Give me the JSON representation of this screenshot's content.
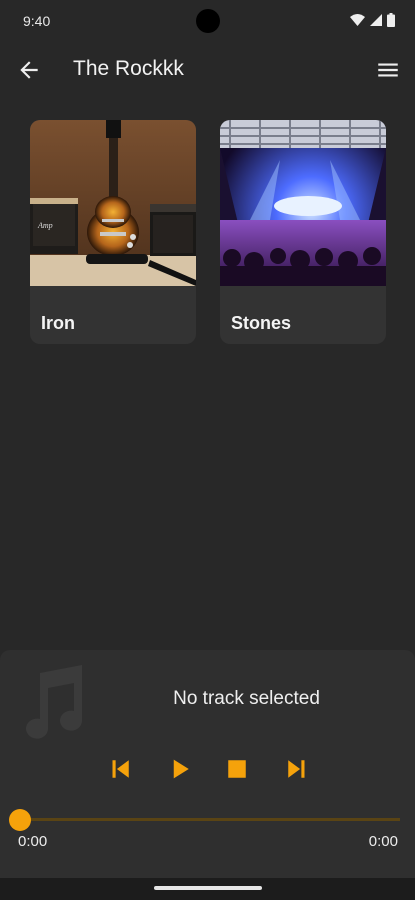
{
  "status_bar": {
    "time": "9:40",
    "icons": [
      "wifi-icon",
      "signal-icon",
      "battery-icon"
    ]
  },
  "app_bar": {
    "title": "The Rockkk",
    "back_icon": "arrow-back-icon",
    "menu_icon": "menu-icon"
  },
  "albums": [
    {
      "label": "Iron",
      "image": "electric guitar with amplifiers"
    },
    {
      "label": "Stones",
      "image": "concert stage with crowd"
    }
  ],
  "player": {
    "status_text": "No track selected",
    "placeholder_icon": "music-note-icon",
    "controls": [
      "skip-previous-icon",
      "play-icon",
      "stop-icon",
      "skip-next-icon"
    ],
    "progress": 0,
    "elapsed": "0:00",
    "duration": "0:00"
  },
  "colors": {
    "accent": "#f5a20b",
    "background": "#282828",
    "card": "#333333",
    "player": "#2f2f2f"
  }
}
